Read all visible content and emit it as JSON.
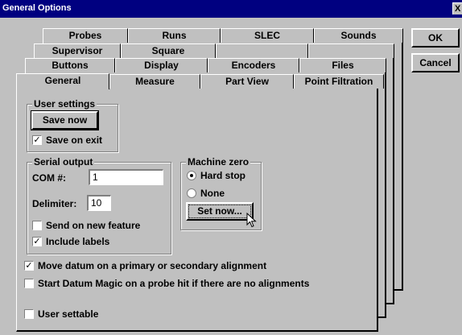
{
  "window": {
    "title": "General Options",
    "close_glyph": "X"
  },
  "tabs": {
    "row1": [
      "Probes",
      "Runs",
      "SLEC",
      "Sounds"
    ],
    "row2": [
      "Supervisor",
      "Square"
    ],
    "row3": [
      "Buttons",
      "Display",
      "Encoders",
      "Files"
    ],
    "row4": [
      "General",
      "Measure",
      "Part View",
      "Point Filtration"
    ],
    "active": "General"
  },
  "buttons": {
    "ok": "OK",
    "cancel": "Cancel",
    "set_now": "Set now..."
  },
  "user_settings": {
    "title": "User settings",
    "save_now": "Save now",
    "save_on_exit": {
      "label": "Save on exit",
      "checked": true
    }
  },
  "serial_output": {
    "title": "Serial output",
    "com_label": "COM #:",
    "com_value": "1",
    "delimiter_label": "Delimiter:",
    "delimiter_value": "10",
    "send_on_new_feature": {
      "label": "Send on new feature",
      "checked": false
    },
    "include_labels": {
      "label": "Include labels",
      "checked": true
    }
  },
  "machine_zero": {
    "title": "Machine zero",
    "hard_stop": {
      "label": "Hard stop",
      "selected": true
    },
    "none": {
      "label": "None",
      "selected": false
    }
  },
  "options": {
    "move_datum": {
      "label": "Move datum on a primary or secondary alignment",
      "checked": true
    },
    "start_datum_magic": {
      "label": "Start Datum Magic on a probe hit if there are no alignments",
      "checked": false
    },
    "user_settable": {
      "label": "User settable",
      "checked": false
    }
  }
}
